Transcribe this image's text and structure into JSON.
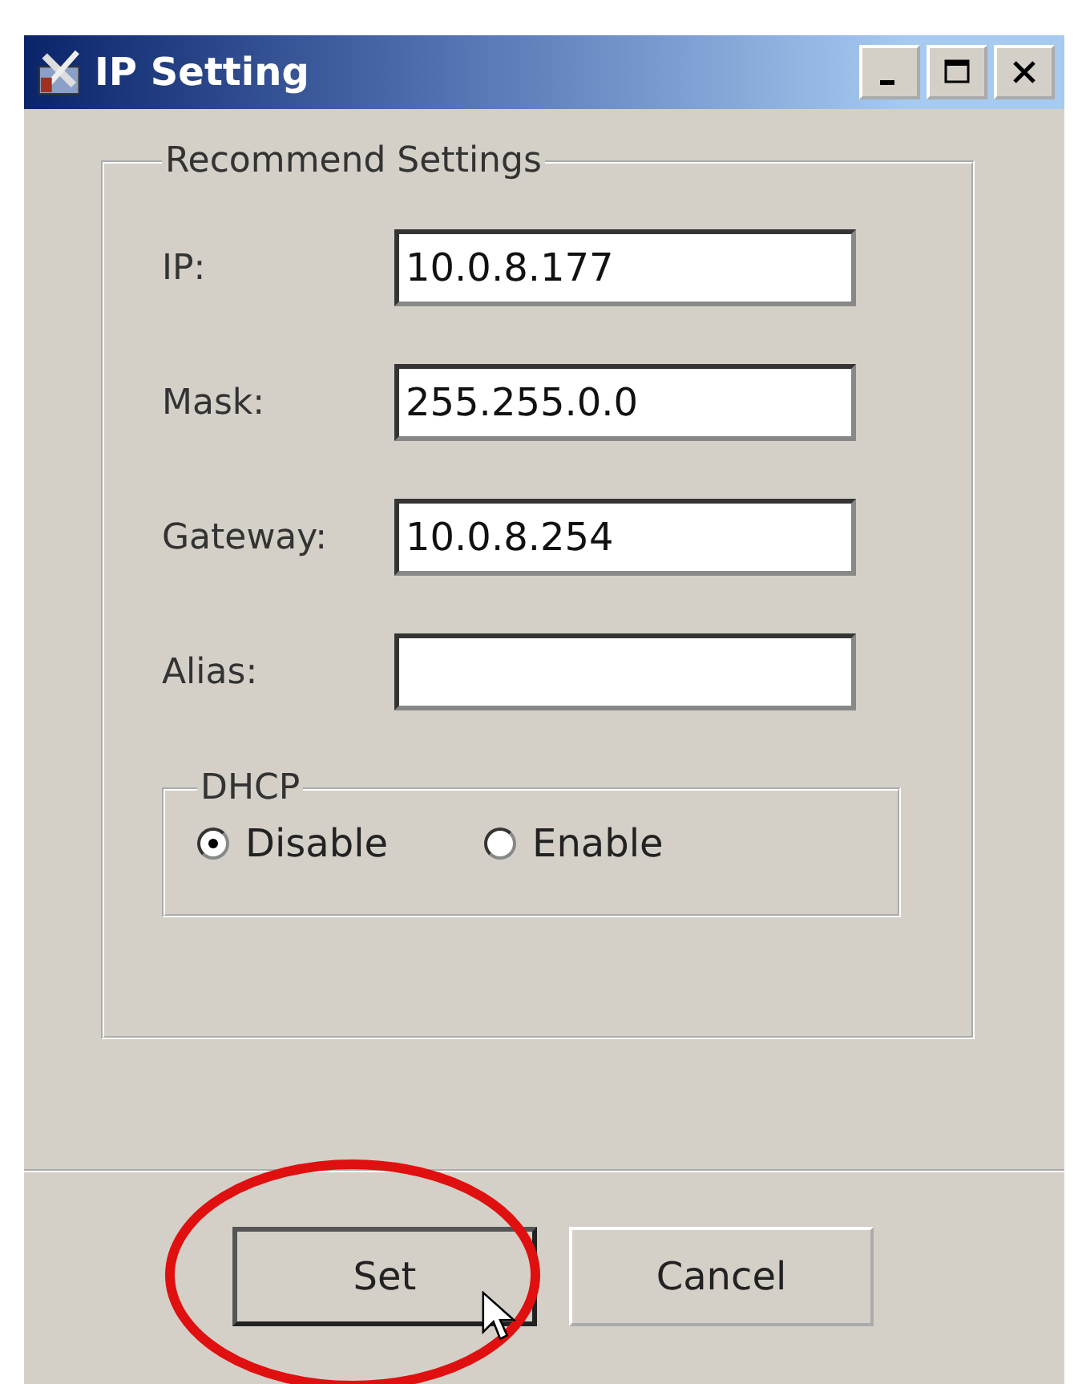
{
  "window": {
    "title": "IP Setting"
  },
  "group": {
    "title": "Recommend Settings",
    "fields": [
      {
        "label": "IP:",
        "value": "10.0.8.177"
      },
      {
        "label": "Mask:",
        "value": "255.255.0.0"
      },
      {
        "label": "Gateway:",
        "value": "10.0.8.254"
      },
      {
        "label": "Alias:"
      }
    ],
    "dhcp": {
      "title": "DHCP",
      "options": [
        {
          "label": "Disable",
          "selected": true
        },
        {
          "label": "Enable",
          "selected": false
        }
      ]
    }
  },
  "buttons": [
    {
      "label": "Set",
      "default": true,
      "circled": true
    },
    {
      "label": "Cancel",
      "default": false,
      "circled": false
    }
  ]
}
